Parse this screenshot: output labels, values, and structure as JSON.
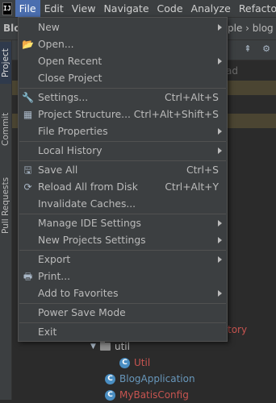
{
  "menubar": {
    "logo": "IJ",
    "items": [
      "File",
      "Edit",
      "View",
      "Navigate",
      "Code",
      "Analyze",
      "Refactor"
    ]
  },
  "nav": {
    "left": "Blo",
    "right": "ple › blog"
  },
  "side_tabs": {
    "project": "Project",
    "commit": "Commit",
    "pull": "Pull Requests"
  },
  "background": {
    "ghost": "ad",
    "history_fragment": "tory",
    "tree": [
      {
        "label": "util",
        "kind": "folder"
      },
      {
        "label": "Util",
        "kind": "class"
      },
      {
        "label": "BlogApplication",
        "kind": "class"
      },
      {
        "label": "MyBatisConfig",
        "kind": "class"
      }
    ]
  },
  "file_menu": {
    "items": [
      {
        "label": "New",
        "shortcut": "",
        "submenu": true,
        "icon": ""
      },
      {
        "label": "Open...",
        "shortcut": "",
        "submenu": false,
        "icon": "folder-open-icon"
      },
      {
        "label": "Open Recent",
        "shortcut": "",
        "submenu": true,
        "icon": ""
      },
      {
        "label": "Close Project",
        "shortcut": "",
        "submenu": false,
        "icon": ""
      },
      {
        "label": "Settings...",
        "shortcut": "Ctrl+Alt+S",
        "submenu": false,
        "icon": "wrench-icon"
      },
      {
        "label": "Project Structure...",
        "shortcut": "Ctrl+Alt+Shift+S",
        "submenu": false,
        "icon": "project-structure-icon"
      },
      {
        "label": "File Properties",
        "shortcut": "",
        "submenu": true,
        "icon": ""
      },
      {
        "label": "Local History",
        "shortcut": "",
        "submenu": true,
        "icon": ""
      },
      {
        "label": "Save All",
        "shortcut": "Ctrl+S",
        "submenu": false,
        "icon": "save-icon"
      },
      {
        "label": "Reload All from Disk",
        "shortcut": "Ctrl+Alt+Y",
        "submenu": false,
        "icon": "reload-icon"
      },
      {
        "label": "Invalidate Caches...",
        "shortcut": "",
        "submenu": false,
        "icon": ""
      },
      {
        "label": "Manage IDE Settings",
        "shortcut": "",
        "submenu": true,
        "icon": ""
      },
      {
        "label": "New Projects Settings",
        "shortcut": "",
        "submenu": true,
        "icon": ""
      },
      {
        "label": "Export",
        "shortcut": "",
        "submenu": true,
        "icon": ""
      },
      {
        "label": "Print...",
        "shortcut": "",
        "submenu": false,
        "icon": "printer-icon"
      },
      {
        "label": "Add to Favorites",
        "shortcut": "",
        "submenu": true,
        "icon": ""
      },
      {
        "label": "Power Save Mode",
        "shortcut": "",
        "submenu": false,
        "icon": ""
      },
      {
        "label": "Exit",
        "shortcut": "",
        "submenu": false,
        "icon": ""
      }
    ]
  },
  "colors": {
    "menu_bg": "#3c3f41",
    "active": "#4b6eaf",
    "error_text": "#c75450",
    "class_icon": "#4a8ec2"
  }
}
